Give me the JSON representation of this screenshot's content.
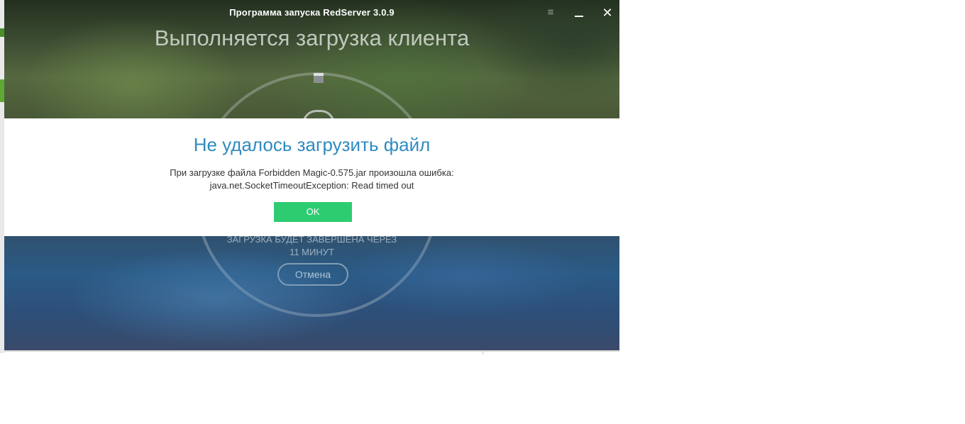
{
  "window": {
    "title": "Программа запуска RedServer 3.0.9",
    "menu_icon": "≡",
    "close_icon": "✕"
  },
  "launcher": {
    "heading": "Выполняется загрузка клиента",
    "eta_line1": "ЗАГРУЗКА БУДЕТ ЗАВЕРШЕНА ЧЕРЕЗ",
    "eta_line2": "11 МИНУТ",
    "cancel_label": "Отмена"
  },
  "dialog": {
    "title": "Не удалось загрузить файл",
    "message_line1": "При загрузке файла Forbidden Magic-0.575.jar произошла ошибка:",
    "message_line2": "java.net.SocketTimeoutException: Read timed out",
    "ok_label": "OK"
  },
  "colors": {
    "dialog_title": "#2f8bbf",
    "ok_button": "#2ecc71"
  }
}
